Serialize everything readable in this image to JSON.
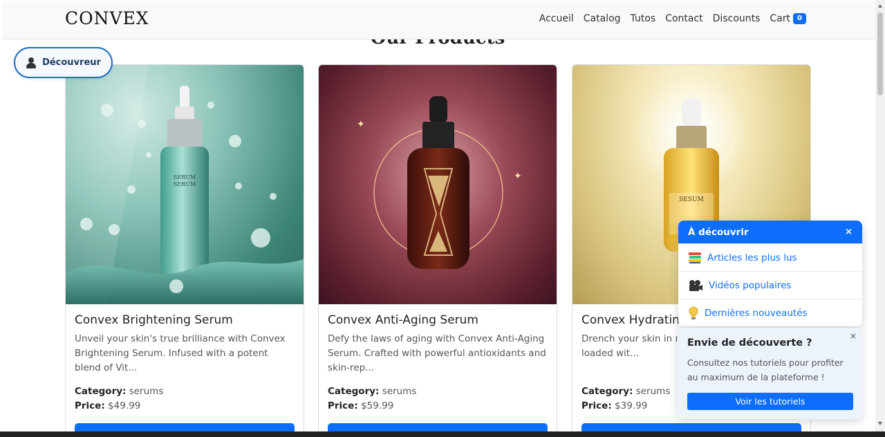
{
  "brand": "CONVEX",
  "nav": {
    "items": [
      "Accueil",
      "Catalog",
      "Tutos",
      "Contact",
      "Discounts"
    ],
    "cart_label": "Cart",
    "cart_count": "0"
  },
  "section_title": "Our Products",
  "decouvreur_label": "Découvreur",
  "products": [
    {
      "name": "Convex Brightening Serum",
      "description": "Unveil your skin's true brilliance with Convex Brightening Serum. Infused with a potent blend of Vit...",
      "category_label": "Category:",
      "category": "serums",
      "price_label": "Price:",
      "price": "$49.99",
      "bottle_text": "SERUM SERUM"
    },
    {
      "name": "Convex Anti-Aging Serum",
      "description": "Defy the laws of aging with Convex Anti-Aging Serum. Crafted with powerful antioxidants and skin-rep...",
      "category_label": "Category:",
      "category": "serums",
      "price_label": "Price:",
      "price": "$59.99"
    },
    {
      "name": "Convex Hydrating",
      "description": "Drench your skin in m Hydrating Serum. Thi is loaded wit...",
      "category_label": "Category:",
      "category": "serums",
      "price_label": "Price:",
      "price": "$39.99",
      "bottle_text": "SESUM"
    }
  ],
  "discover_panel": {
    "title": "À découvrir",
    "close": "×",
    "items": [
      {
        "label": "Articles les plus lus",
        "icon": "books-icon"
      },
      {
        "label": "Vidéos populaires",
        "icon": "film-camera-icon"
      },
      {
        "label": "Dernières nouveautés",
        "icon": "lightbulb-icon"
      }
    ]
  },
  "tip_card": {
    "title": "Envie de découverte ?",
    "text": "Consultez nos tutoriels pour profiter au maximum de la plateforme !",
    "button": "Voir les tutoriels",
    "close": "×"
  },
  "colors": {
    "primary": "#0d6efd",
    "navbar_bg": "#f8f9fa"
  }
}
